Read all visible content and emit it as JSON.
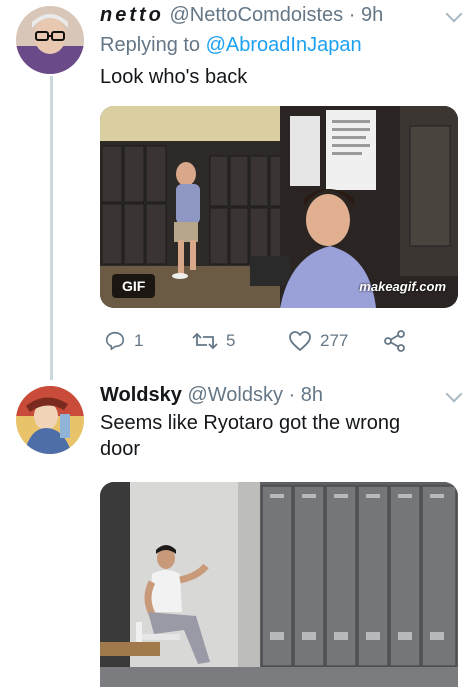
{
  "tweet1": {
    "display_name": "netto",
    "handle": "@NettoComdoistes",
    "separator": "·",
    "time": "9h",
    "reply_prefix": "Replying to",
    "reply_handle": "@AbroadInJapan",
    "text": "Look who's back",
    "media": {
      "badge": "GIF",
      "watermark": "makeagif.com"
    },
    "actions": {
      "reply_count": "1",
      "retweet_count": "5",
      "like_count": "277"
    }
  },
  "tweet2": {
    "display_name": "Woldsky",
    "handle": "@Woldsky",
    "separator": "·",
    "time": "8h",
    "text_line1": "Seems like Ryotaro got the wrong",
    "text_line2": "door"
  },
  "colors": {
    "secondary_text": "#657786",
    "link": "#1da1f2",
    "thread_line": "#ccd6dd"
  },
  "icons": [
    "reply-icon",
    "retweet-icon",
    "like-icon",
    "share-icon",
    "chevron-down-icon"
  ]
}
